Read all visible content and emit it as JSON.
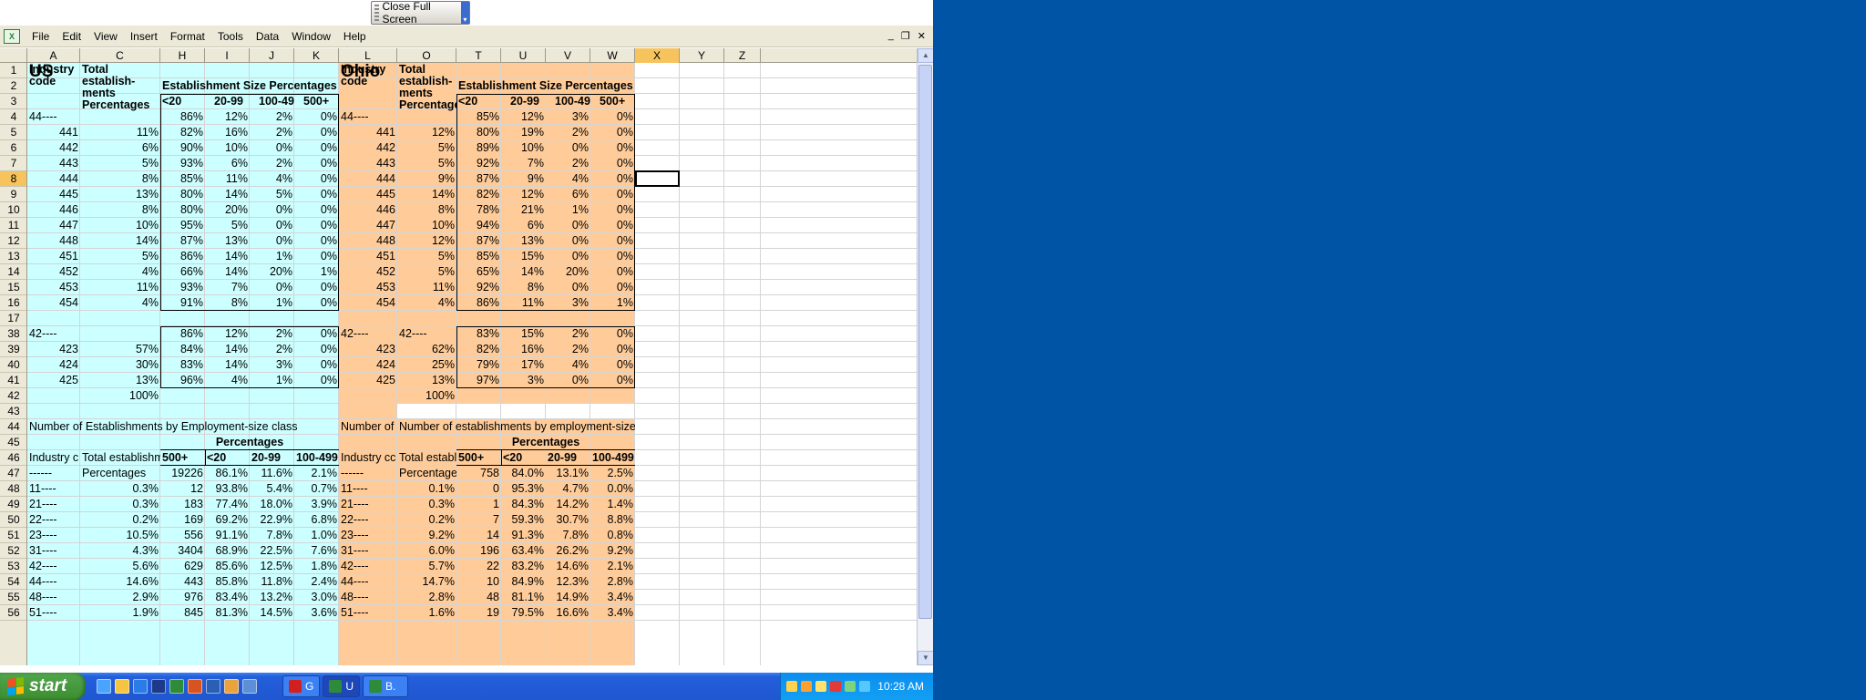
{
  "toolbar": {
    "close_full_screen": "Close Full Screen"
  },
  "menu": [
    "File",
    "Edit",
    "View",
    "Insert",
    "Format",
    "Tools",
    "Data",
    "Window",
    "Help"
  ],
  "window_controls": {
    "minimize": "_",
    "restore": "❐",
    "close": "✕"
  },
  "columns": [
    "A",
    "C",
    "H",
    "I",
    "J",
    "K",
    "L",
    "O",
    "T",
    "U",
    "V",
    "W",
    "X",
    "Y",
    "Z"
  ],
  "rows": [
    "1",
    "2",
    "3",
    "4",
    "5",
    "6",
    "7",
    "8",
    "9",
    "10",
    "11",
    "12",
    "13",
    "14",
    "15",
    "16",
    "17",
    "38",
    "39",
    "40",
    "41",
    "42",
    "43",
    "44",
    "45",
    "46",
    "47",
    "48",
    "49",
    "50",
    "51",
    "52",
    "53",
    "54",
    "55",
    "56"
  ],
  "selected_row": "8",
  "selected_col": "X",
  "colors": {
    "us_fill": "#ccffff",
    "ohio_fill": "#ffcc99",
    "selection": "#f7c35d"
  },
  "us": {
    "title": "US",
    "section_title": "Establishment Size Percentages",
    "hdr_industry1": "Industry",
    "hdr_industry2": "code",
    "hdr_total1": "Total",
    "hdr_total2": "establish-",
    "hdr_total3": "ments",
    "hdr_total4": "Percentages",
    "size_hdr": [
      "<20",
      "20-99",
      "100-499",
      "500+"
    ],
    "block1": [
      [
        "44----",
        "",
        "86%",
        "12%",
        "2%",
        "0%"
      ],
      [
        "441",
        "11%",
        "82%",
        "16%",
        "2%",
        "0%"
      ],
      [
        "442",
        "6%",
        "90%",
        "10%",
        "0%",
        "0%"
      ],
      [
        "443",
        "5%",
        "93%",
        "6%",
        "2%",
        "0%"
      ],
      [
        "444",
        "8%",
        "85%",
        "11%",
        "4%",
        "0%"
      ],
      [
        "445",
        "13%",
        "80%",
        "14%",
        "5%",
        "0%"
      ],
      [
        "446",
        "8%",
        "80%",
        "20%",
        "0%",
        "0%"
      ],
      [
        "447",
        "10%",
        "95%",
        "5%",
        "0%",
        "0%"
      ],
      [
        "448",
        "14%",
        "87%",
        "13%",
        "0%",
        "0%"
      ],
      [
        "451",
        "5%",
        "86%",
        "14%",
        "1%",
        "0%"
      ],
      [
        "452",
        "4%",
        "66%",
        "14%",
        "20%",
        "1%"
      ],
      [
        "453",
        "11%",
        "93%",
        "7%",
        "0%",
        "0%"
      ],
      [
        "454",
        "4%",
        "91%",
        "8%",
        "1%",
        "0%"
      ]
    ],
    "block2": [
      [
        "42----",
        "",
        "86%",
        "12%",
        "2%",
        "0%"
      ],
      [
        "423",
        "57%",
        "84%",
        "14%",
        "2%",
        "0%"
      ],
      [
        "424",
        "30%",
        "83%",
        "14%",
        "3%",
        "0%"
      ],
      [
        "425",
        "13%",
        "96%",
        "4%",
        "1%",
        "0%"
      ]
    ],
    "total_pct": "100%",
    "num_title": "Number of Establishments by Employment-size class",
    "pct_title": "Percentages",
    "num_hdr": [
      "Industry c",
      "Total establishm",
      "500+",
      "<20",
      "20-99",
      "100-499"
    ],
    "block3": [
      [
        "------",
        "Percentages",
        "19226",
        "86.1%",
        "11.6%",
        "2.1%"
      ],
      [
        "11----",
        "0.3%",
        "12",
        "93.8%",
        "5.4%",
        "0.7%"
      ],
      [
        "21----",
        "0.3%",
        "183",
        "77.4%",
        "18.0%",
        "3.9%"
      ],
      [
        "22----",
        "0.2%",
        "169",
        "69.2%",
        "22.9%",
        "6.8%"
      ],
      [
        "23----",
        "10.5%",
        "556",
        "91.1%",
        "7.8%",
        "1.0%"
      ],
      [
        "31----",
        "4.3%",
        "3404",
        "68.9%",
        "22.5%",
        "7.6%"
      ],
      [
        "42----",
        "5.6%",
        "629",
        "85.6%",
        "12.5%",
        "1.8%"
      ],
      [
        "44----",
        "14.6%",
        "443",
        "85.8%",
        "11.8%",
        "2.4%"
      ],
      [
        "48----",
        "2.9%",
        "976",
        "83.4%",
        "13.2%",
        "3.0%"
      ],
      [
        "51----",
        "1.9%",
        "845",
        "81.3%",
        "14.5%",
        "3.6%"
      ]
    ]
  },
  "ohio": {
    "title": "Ohio",
    "section_title": "Establishment Size Percentages",
    "hdr_industry1": "Industry",
    "hdr_industry2": "code",
    "hdr_total1": "Total",
    "hdr_total2": "establish-",
    "hdr_total3": "ments",
    "hdr_total4": "Percentages",
    "size_hdr": [
      "<20",
      "20-99",
      "100-499",
      "500+"
    ],
    "block1": [
      [
        "44----",
        "",
        "85%",
        "12%",
        "3%",
        "0%"
      ],
      [
        "441",
        "12%",
        "80%",
        "19%",
        "2%",
        "0%"
      ],
      [
        "442",
        "5%",
        "89%",
        "10%",
        "0%",
        "0%"
      ],
      [
        "443",
        "5%",
        "92%",
        "7%",
        "2%",
        "0%"
      ],
      [
        "444",
        "9%",
        "87%",
        "9%",
        "4%",
        "0%"
      ],
      [
        "445",
        "14%",
        "82%",
        "12%",
        "6%",
        "0%"
      ],
      [
        "446",
        "8%",
        "78%",
        "21%",
        "1%",
        "0%"
      ],
      [
        "447",
        "10%",
        "94%",
        "6%",
        "0%",
        "0%"
      ],
      [
        "448",
        "12%",
        "87%",
        "13%",
        "0%",
        "0%"
      ],
      [
        "451",
        "5%",
        "85%",
        "15%",
        "0%",
        "0%"
      ],
      [
        "452",
        "5%",
        "65%",
        "14%",
        "20%",
        "0%"
      ],
      [
        "453",
        "11%",
        "92%",
        "8%",
        "0%",
        "0%"
      ],
      [
        "454",
        "4%",
        "86%",
        "11%",
        "3%",
        "1%"
      ]
    ],
    "block2": [
      [
        "42----",
        "42----",
        "83%",
        "15%",
        "2%",
        "0%"
      ],
      [
        "423",
        "62%",
        "82%",
        "16%",
        "2%",
        "0%"
      ],
      [
        "424",
        "25%",
        "79%",
        "17%",
        "4%",
        "0%"
      ],
      [
        "425",
        "13%",
        "97%",
        "3%",
        "0%",
        "0%"
      ]
    ],
    "total_pct": "100%",
    "num_title1": "Number of",
    "num_title2": "Number of establishments by employment-size class",
    "pct_title": "Percentages",
    "num_hdr": [
      "Industry cc",
      "Total establish",
      "500+",
      "<20",
      "20-99",
      "100-499"
    ],
    "block3": [
      [
        "------",
        "Percentages",
        "758",
        "84.0%",
        "13.1%",
        "2.5%"
      ],
      [
        "11----",
        "0.1%",
        "0",
        "95.3%",
        "4.7%",
        "0.0%"
      ],
      [
        "21----",
        "0.3%",
        "1",
        "84.3%",
        "14.2%",
        "1.4%"
      ],
      [
        "22----",
        "0.2%",
        "7",
        "59.3%",
        "30.7%",
        "8.8%"
      ],
      [
        "23----",
        "9.2%",
        "14",
        "91.3%",
        "7.8%",
        "0.8%"
      ],
      [
        "31----",
        "6.0%",
        "196",
        "63.4%",
        "26.2%",
        "9.2%"
      ],
      [
        "42----",
        "5.7%",
        "22",
        "83.2%",
        "14.6%",
        "2.1%"
      ],
      [
        "44----",
        "14.7%",
        "10",
        "84.9%",
        "12.3%",
        "2.8%"
      ],
      [
        "48----",
        "2.8%",
        "48",
        "81.1%",
        "14.9%",
        "3.4%"
      ],
      [
        "51----",
        "1.6%",
        "19",
        "79.5%",
        "16.6%",
        "3.4%"
      ]
    ]
  },
  "taskbar": {
    "start": "start",
    "tasks": [
      "G",
      "U",
      "B."
    ],
    "clock": "10:28 AM"
  }
}
